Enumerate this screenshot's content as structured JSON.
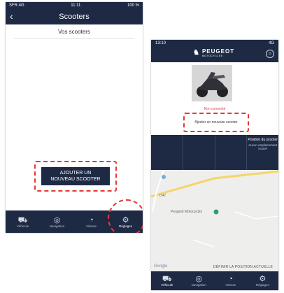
{
  "phone1": {
    "status": {
      "left": "SFR 4G",
      "center": "11:11",
      "right": "100 %"
    },
    "title": "Scooters",
    "subtitle": "Vos scooters",
    "add_button": {
      "line1": "AJOUTER UN",
      "line2": "NOUVEAU SCOOTER"
    },
    "tabs": [
      {
        "label": "Véhicule",
        "icon": "scooter-icon"
      },
      {
        "label": "Navigation",
        "icon": "navigation-icon"
      },
      {
        "label": "Vitesse",
        "icon": "speedometer-icon"
      },
      {
        "label": "Réglages",
        "icon": "gear-icon"
      }
    ]
  },
  "phone2": {
    "status": {
      "time": "13:10",
      "right": "4G"
    },
    "brand": "PEUGEOT",
    "brand_sub": "MOTOCYCLES",
    "not_connected": "Non connecté",
    "add_link": "Ajouter un nouveau scooter",
    "position_title": "Position du scooter",
    "position_desc": "Aucun emplacement trouvé",
    "map_labels": {
      "road": "D47",
      "poi": "Peugeot Motocycles",
      "google": "Google"
    },
    "set_position": "DÉFINIR LA POSITION ACTUELLE",
    "tabs": [
      {
        "label": "Véhicule"
      },
      {
        "label": "Navigation"
      },
      {
        "label": "Vitesse"
      },
      {
        "label": "Réglages"
      }
    ]
  },
  "colors": {
    "navy": "#1e2a44",
    "highlight": "#e53935"
  }
}
